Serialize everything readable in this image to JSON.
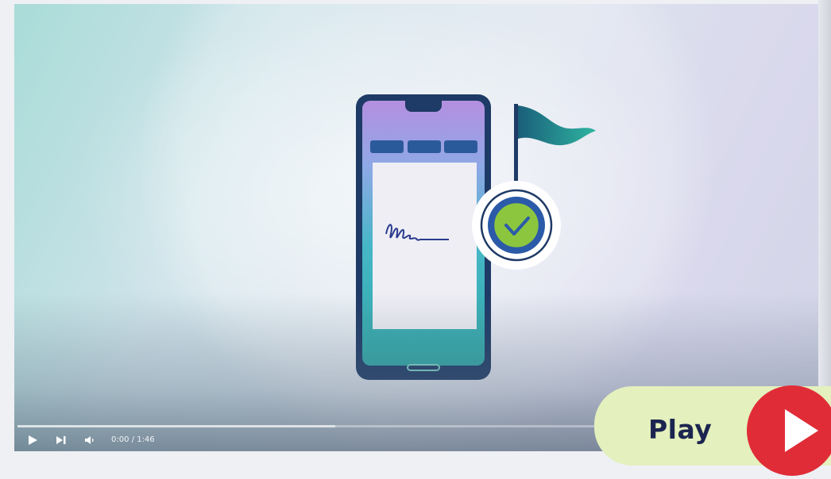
{
  "video": {
    "time_current": "0:00",
    "time_separator": " / ",
    "time_total": "1:46",
    "progress": 0,
    "buffered": 0.54
  },
  "controls": {
    "play_icon": "play-icon",
    "next_icon": "skip-next-icon",
    "volume_icon": "volume-icon"
  },
  "overlay": {
    "play_label": "Play",
    "play_icon": "play-triangle-icon"
  },
  "colors": {
    "badge_bg": "#e4f0bd",
    "play_red": "#e02c37",
    "label_navy": "#1b2550",
    "flag_teal": "#1f8a8a",
    "check_green": "#8cc63f",
    "signature_blue": "#2a3b8f"
  }
}
